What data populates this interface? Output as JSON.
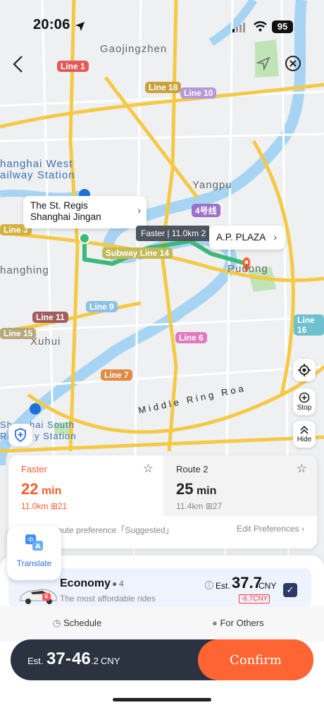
{
  "status": {
    "time": "20:06",
    "battery": "95"
  },
  "map": {
    "places": [
      "Gaojingzhen",
      "Yangpu",
      "Xuhui",
      "hanghai West",
      "ailway Station",
      "hanghing",
      "Sh",
      "hai South",
      "Ra",
      "y Station",
      "Middle Ring Roa",
      "Pudong"
    ],
    "lines": [
      "Line 1",
      "Line 18",
      "Line 10",
      "Line 3",
      "4号线",
      "Subway Line 14",
      "Line 9",
      "Line 11",
      "Line 6",
      "Line 15",
      "Line 7",
      "Line 16"
    ],
    "origin_callout": "The St. Regis Shanghai Jingan",
    "route_tag": "Faster | 11.0km 2",
    "dest_callout": "A.P. PLAZA",
    "stop_label": "Stop",
    "hide_label": "Hide"
  },
  "routes": [
    {
      "name": "Faster",
      "time": "22",
      "unit": "min",
      "dist": "11.0km",
      "toll": "21"
    },
    {
      "name": "Route 2",
      "time": "25",
      "unit": "min",
      "dist": "11.4km",
      "toll": "27"
    }
  ],
  "pref": {
    "text": "nt route preference「Suggested」",
    "edit": "Edit Preferences"
  },
  "translate": {
    "label": "Translate"
  },
  "ride": {
    "name": "Economy",
    "seats": "4",
    "desc": "The most affordable rides",
    "est": "Est.",
    "price": "37.7",
    "currency": "CNY",
    "discount": "-6.7CNY"
  },
  "options": {
    "schedule": "Schedule",
    "others": "For Others"
  },
  "total": {
    "est": "Est.",
    "low": "37",
    "high": "46",
    "dec": ".2",
    "currency": "CNY",
    "confirm": "Confirm"
  },
  "colors": {
    "accent": "#ff6433",
    "route": "#3cb878",
    "checkbox": "#2b3a67"
  }
}
